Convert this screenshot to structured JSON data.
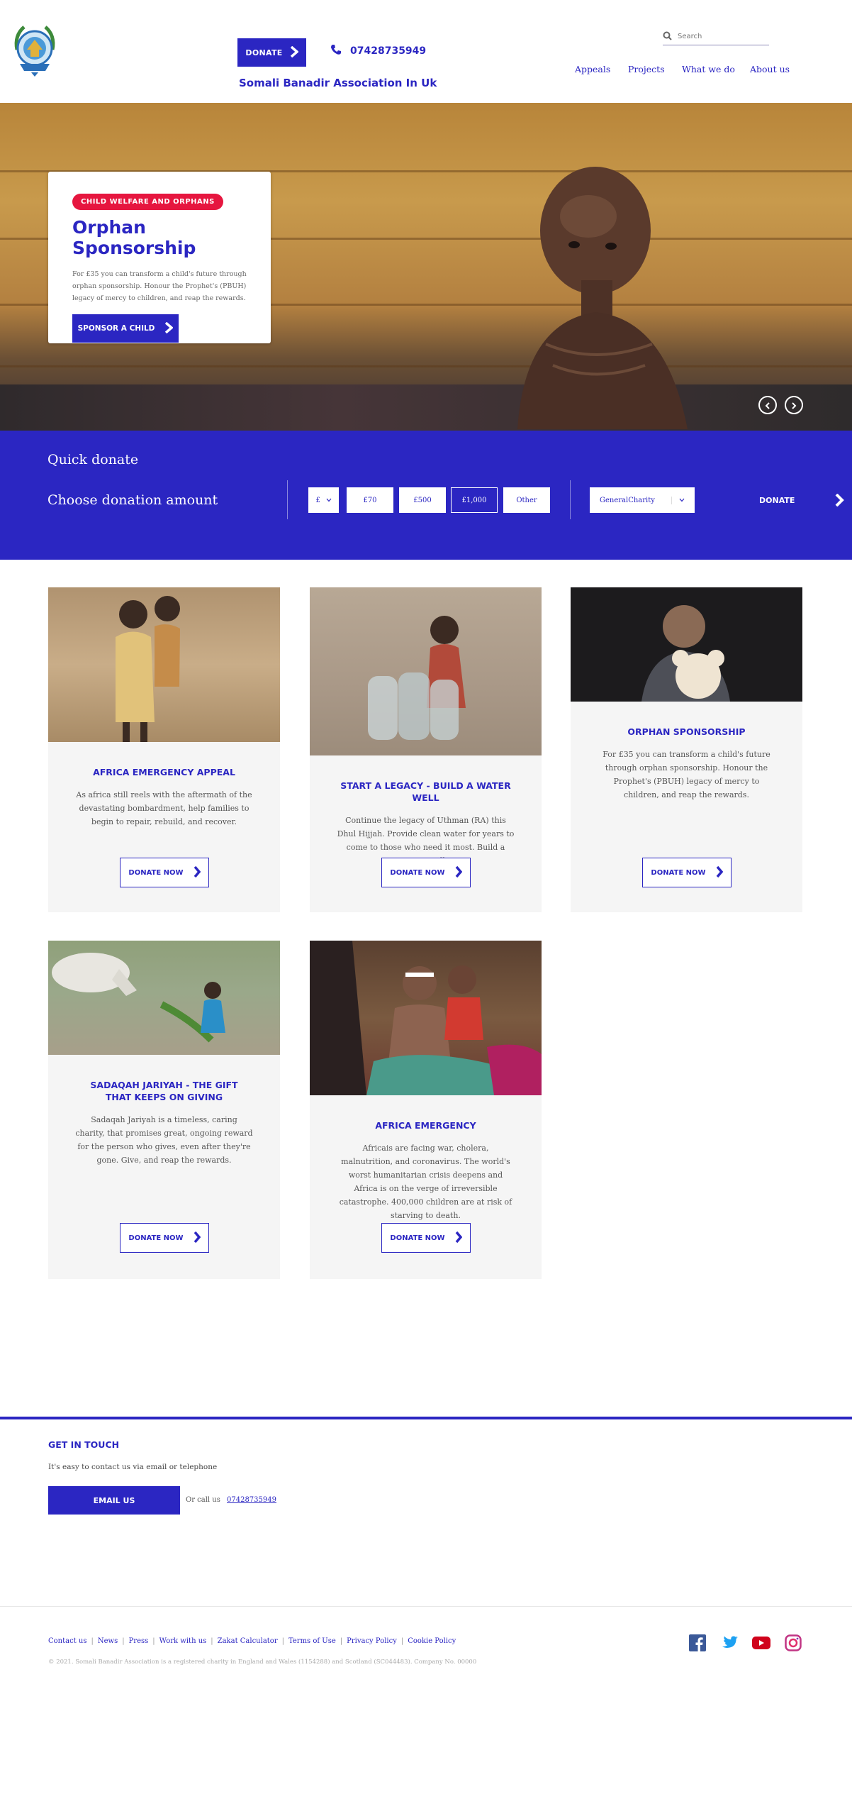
{
  "header": {
    "donate_label": "DONATE",
    "phone": "07428735949",
    "org_name": "Somali Banadir Association In Uk",
    "search_placeholder": "Search",
    "nav": [
      "Appeals",
      "Projects",
      "What we do",
      "About us"
    ]
  },
  "hero": {
    "tag": "CHILD WELFARE AND ORPHANS",
    "title": "Orphan Sponsorship",
    "text": "For £35 you can transform a child's future through orphan sponsorship. Honour the Prophet's (PBUH) legacy of mercy to children, and reap the rewards.",
    "button": "SPONSOR A CHILD"
  },
  "quick_donate": {
    "title": "Quick donate",
    "choose_label": "Choose donation amount",
    "currency": "£",
    "amounts": [
      "£70",
      "£500",
      "£1,000",
      "Other"
    ],
    "selected_amount": "£1,000",
    "fund": "GeneralCharity",
    "donate_label": "DONATE"
  },
  "cards": [
    {
      "title": "AFRICA EMERGENCY APPEAL",
      "text": "As africa still reels with the aftermath of the devastating bombardment, help families to begin to repair, rebuild, and recover.",
      "button": "DONATE NOW"
    },
    {
      "title": "START A LEGACY - BUILD A WATER WELL",
      "text": "Continue the legacy of Uthman (RA) this Dhul Hijjah. Provide clean water for years to come to those who need it most. Build a water well.",
      "button": "DONATE NOW"
    },
    {
      "title": "ORPHAN SPONSORSHIP",
      "text": "For £35 you can transform a child's future through orphan sponsorship. Honour the Prophet's (PBUH) legacy of mercy to children, and reap the rewards.",
      "button": "DONATE NOW"
    },
    {
      "title": "SADAQAH JARIYAH - THE GIFT THAT KEEPS ON GIVING",
      "text": "Sadaqah Jariyah is a timeless, caring charity, that promises great, ongoing reward for the person who gives, even after they're gone. Give, and reap the rewards.",
      "button": "DONATE NOW"
    },
    {
      "title": "AFRICA EMERGENCY",
      "text": "Africais are facing war, cholera, malnutrition, and coronavirus. The world's worst humanitarian crisis deepens and Africa is on the verge of irreversible catastrophe. 400,000 children are at risk of starving to death.",
      "button": "DONATE NOW"
    }
  ],
  "contact": {
    "title": "GET IN TOUCH",
    "text": "It's easy to contact us via email or telephone",
    "email_button": "EMAIL US",
    "or_call": "Or call us",
    "phone": "07428735949"
  },
  "footer": {
    "links": [
      "Contact us",
      "News",
      "Press",
      "Work with us",
      "Zakat Calculator",
      "Terms of Use",
      "Privacy Policy",
      "Cookie Policy"
    ],
    "copyright": "© 2021. Somali Banadir Association is a registered charity in England and Wales (1154288) and Scotland (SC044483). Company No. 00000",
    "social": [
      "facebook-icon",
      "twitter-icon",
      "youtube-icon",
      "instagram-icon"
    ]
  },
  "colors": {
    "brand": "#2b26c2",
    "tag": "#e6163f",
    "card_bg": "#f5f5f5"
  }
}
